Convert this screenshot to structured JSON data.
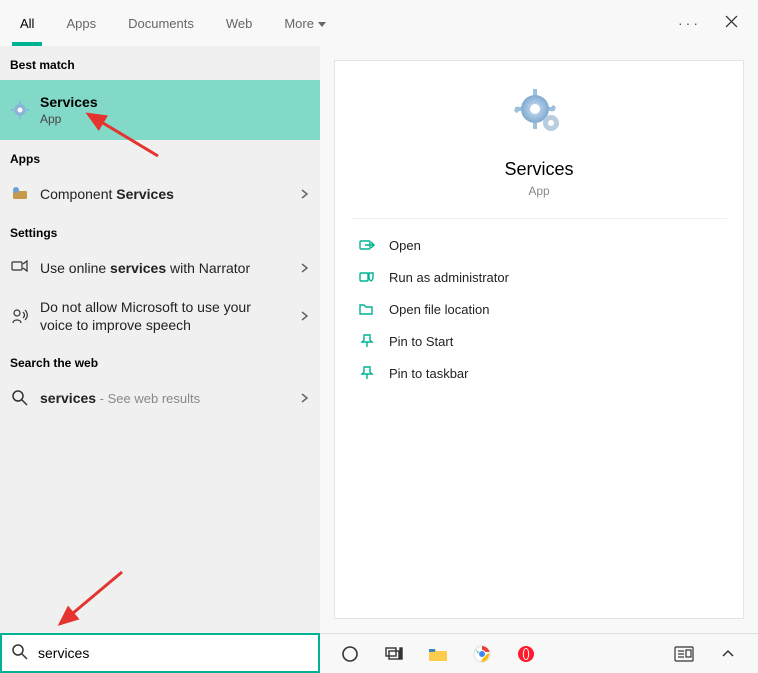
{
  "tabs": {
    "items": [
      "All",
      "Apps",
      "Documents",
      "Web",
      "More"
    ],
    "active_index": 0
  },
  "left": {
    "best_match_header": "Best match",
    "best_match": {
      "title": "Services",
      "sub": "App"
    },
    "apps_header": "Apps",
    "apps_item": {
      "prefix": "Component ",
      "bold": "Services"
    },
    "settings_header": "Settings",
    "settings_items": [
      {
        "prefix": "Use online ",
        "bold": "services",
        "suffix": " with Narrator"
      },
      {
        "text": "Do not allow Microsoft to use your voice to improve speech"
      }
    ],
    "web_header": "Search the web",
    "web_item": {
      "bold": "services",
      "suffix": " - See web results"
    }
  },
  "right": {
    "title": "Services",
    "sub": "App",
    "actions": [
      "Open",
      "Run as administrator",
      "Open file location",
      "Pin to Start",
      "Pin to taskbar"
    ]
  },
  "search_value": "services",
  "colors": {
    "accent": "#00b294",
    "highlight": "#82d9c8"
  }
}
